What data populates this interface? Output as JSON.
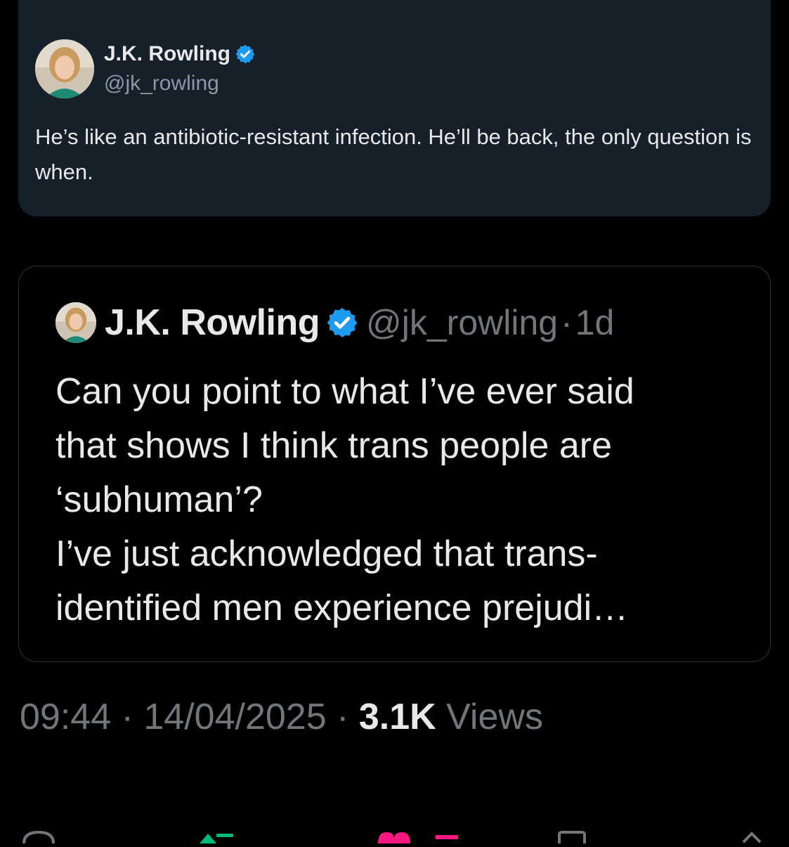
{
  "reply": {
    "author_name": "J.K. Rowling",
    "author_handle": "@jk_rowling",
    "text": "He’s like an antibiotic-resistant infection. He’ll be back, the only question is when."
  },
  "quoted_tweet": {
    "author_name": "J.K. Rowling",
    "author_handle": "@jk_rowling",
    "separator": "·",
    "age": "1d",
    "text_lines": [
      "Can you point to what I’ve ever said",
      "that shows I think trans people are",
      "‘subhuman’?",
      "I’ve just acknowledged that trans-",
      "identified men experience prejudi…"
    ]
  },
  "meta": {
    "time": "09:44",
    "date": "14/04/2025",
    "separator": "·",
    "views_count": "3.1K",
    "views_label": "Views"
  },
  "icons": {
    "verified": "verified-badge-icon",
    "reply": "reply-icon",
    "repost": "repost-icon",
    "like": "heart-icon",
    "views": "views-icon",
    "bookmark": "bookmark-icon",
    "share": "share-icon"
  },
  "colors": {
    "background": "#000000",
    "card_background": "#16202a",
    "verified_blue": "#1d9bf0",
    "secondary_text": "#71767b",
    "repost_green": "#00ba7c",
    "like_pink": "#f91880"
  }
}
